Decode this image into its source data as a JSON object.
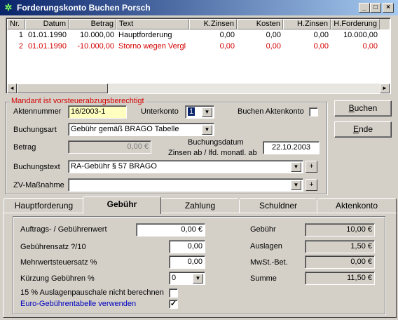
{
  "window": {
    "title": "Forderungskonto Buchen Porsch",
    "minimize": "_",
    "maximize": "□",
    "close": "×"
  },
  "grid": {
    "columns": [
      "Nr.",
      "Datum",
      "Betrag",
      "Text",
      "K.Zinsen",
      "Kosten",
      "H.Zinsen",
      "H.Forderung"
    ],
    "rows": [
      {
        "nr": "1",
        "datum": "01.01.1990",
        "betrag": "10.000,00",
        "text": "Hauptforderung",
        "kzinsen": "0,00",
        "kosten": "0,00",
        "hzinsen": "0,00",
        "hforderung": "10.000,00",
        "highlight": false
      },
      {
        "nr": "2",
        "datum": "01.01.1990",
        "betrag": "-10.000,00",
        "text": "Storno wegen Vergl",
        "kzinsen": "0,00",
        "kosten": "0,00",
        "hzinsen": "0,00",
        "hforderung": "0,00",
        "highlight": true
      }
    ],
    "scroll_left": "◄",
    "scroll_right": "►"
  },
  "form": {
    "group_label": "Mandant ist vorsteuerabzugsberechtigt",
    "aktennummer_label": "Aktennummer",
    "aktennummer_value": "16/2003-1",
    "unterkonto_label": "Unterkonto",
    "unterkonto_value": "1",
    "buchen_aktenkonto_label": "Buchen Aktenkonto",
    "buchungsart_label": "Buchungsart",
    "buchungsart_value": "Gebühr gemäß BRAGO Tabelle",
    "betrag_label": "Betrag",
    "betrag_value": "0,00 €",
    "buchungsdatum_label": "Buchungsdatum",
    "zinsen_label": "Zinsen ab / lfd. monatl. ab",
    "buchungsdatum_value": "22.10.2003",
    "buchungstext_label": "Buchungstext",
    "buchungstext_value": "RA-Gebühr § 57 BRAGO",
    "zv_label": "ZV-Maßnahme",
    "zv_value": "",
    "plus": "+"
  },
  "buttons": {
    "buchen_prefix": "",
    "buchen_ul": "B",
    "buchen_rest": "uchen",
    "ende_prefix": "",
    "ende_ul": "E",
    "ende_rest": "nde"
  },
  "tabs": [
    "Hauptforderung",
    "Gebühr",
    "Zahlung",
    "Schuldner",
    "Aktenkonto"
  ],
  "gebuehr": {
    "auftragswert_label": "Auftrags- / Gebührenwert",
    "auftragswert_value": "0,00 €",
    "gebuehrensatz_label": "Gebührensatz ?/10",
    "gebuehrensatz_value": "0,00",
    "mwst_satz_label": "Mehrwertsteuersatz %",
    "mwst_satz_value": "0,00",
    "kuerzung_label": "Kürzung Gebühren %",
    "kuerzung_value": "0",
    "pauschale_label": "15 % Auslagenpauschale nicht berechnen",
    "pauschale_checked": "",
    "euro_label": "Euro-Gebührentabelle verwenden",
    "euro_checked": "✓",
    "gebuehr_label": "Gebühr",
    "gebuehr_value": "10,00 €",
    "auslagen_label": "Auslagen",
    "auslagen_value": "1,50 €",
    "mwst_label": "MwSt.-Bet.",
    "mwst_value": "0,00 €",
    "summe_label": "Summe",
    "summe_value": "11,50 €"
  },
  "icons": {
    "dropdown": "▼",
    "app": "✲"
  }
}
